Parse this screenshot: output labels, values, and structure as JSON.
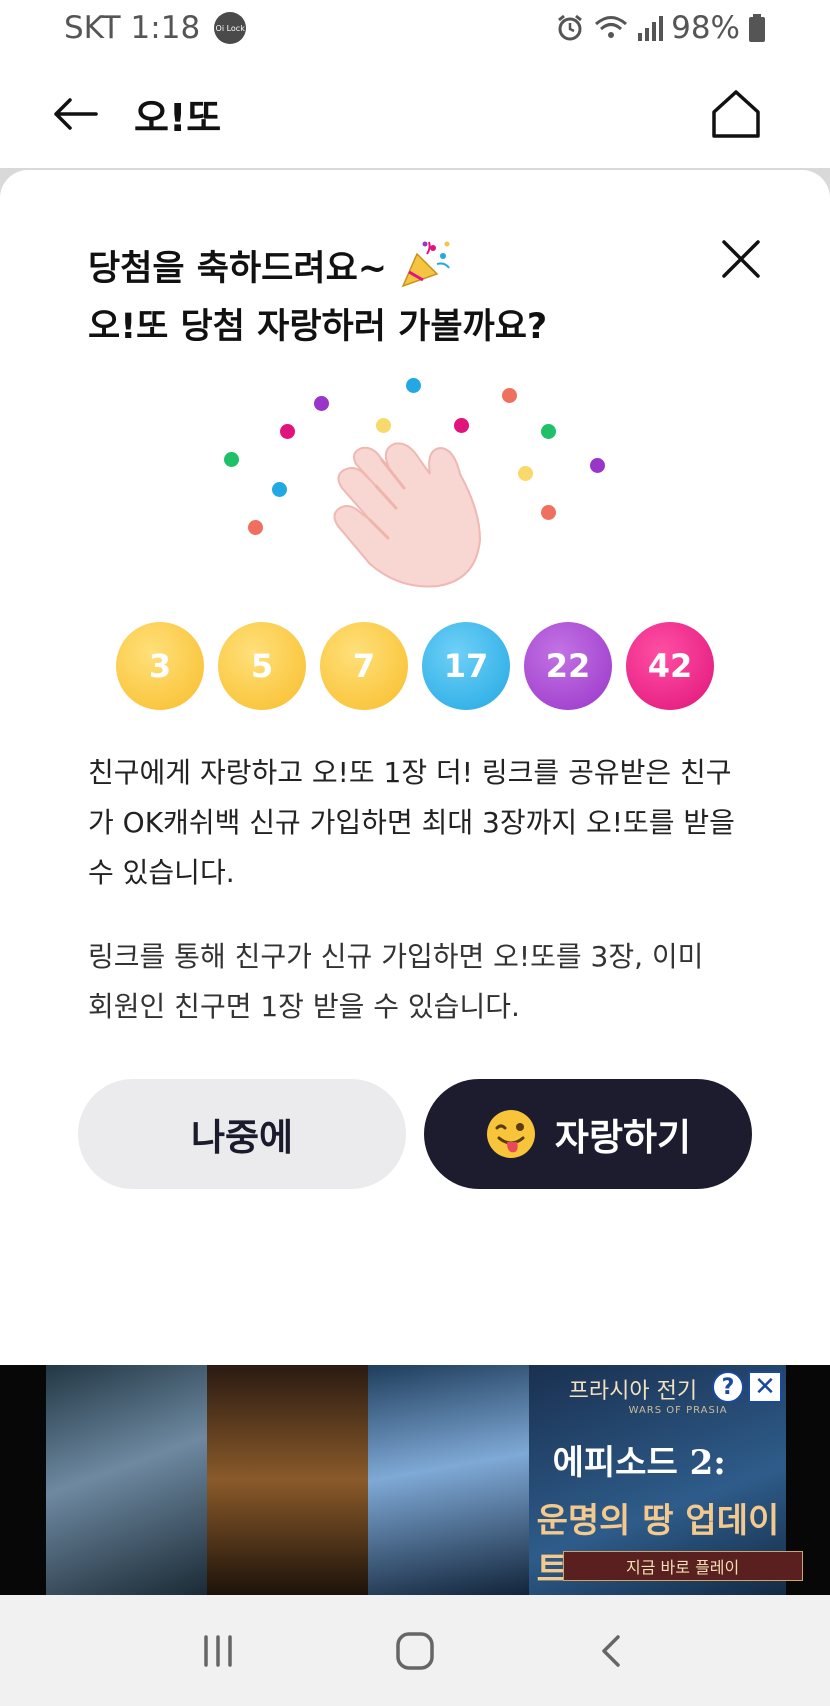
{
  "status_bar": {
    "carrier": "SKT",
    "time": "1:18",
    "lock_badge": "Oi Lock",
    "battery": "98%"
  },
  "header": {
    "title": "오!또"
  },
  "modal": {
    "headline_line1": "당첨을 축하드려요~",
    "headline_line2": "오!또 당첨 자랑하러 가볼까요?",
    "numbers": [
      "3",
      "5",
      "7",
      "17",
      "22",
      "42"
    ],
    "description1": "친구에게 자랑하고 오!또 1장 더! 링크를 공유받은 친구가 OK캐쉬백 신규 가입하면 최대 3장까지 오!또를 받을 수 있습니다.",
    "description2": "링크를 통해 친구가 신규 가입하면 오!또를 3장, 이미 회원인 친구면 1장 받을 수 있습니다.",
    "later_button": "나중에",
    "brag_button": "자랑하기"
  },
  "ad": {
    "brand": "프라시아 전기",
    "brand_sub": "WARS OF PRASIA",
    "line1": "에피소드 2:",
    "line2": "운명의 땅 업데이트",
    "cta": "지금 바로 플레이",
    "help": "?",
    "close": "✕"
  },
  "colors": {
    "ball_yellow": "#f8bd2a",
    "ball_blue": "#22a8e3",
    "ball_purple": "#9a35c9",
    "ball_pink": "#e0147a",
    "primary_button": "#1c1c2e",
    "secondary_button": "#ebebee"
  },
  "icons": [
    "back-arrow-icon",
    "home-icon",
    "close-icon",
    "party-popper-icon",
    "clapping-hand-icon",
    "winking-tongue-emoji-icon",
    "recents-icon",
    "home-circle-icon",
    "back-chevron-icon"
  ]
}
